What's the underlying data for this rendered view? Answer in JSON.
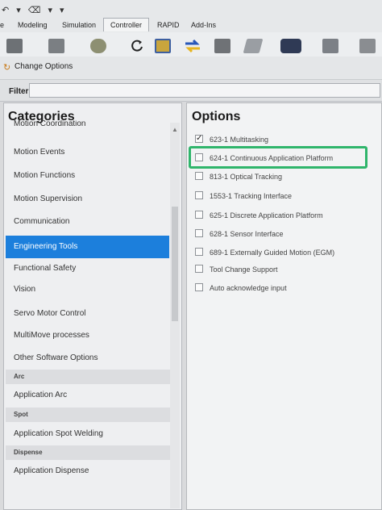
{
  "ribbon": {
    "qat": "↶ ▾ ⌫ ▾ ▾",
    "tabs": [
      {
        "label": "e"
      },
      {
        "label": "Modeling"
      },
      {
        "label": "Simulation"
      },
      {
        "label": "Controller"
      },
      {
        "label": "RAPID"
      },
      {
        "label": "Add-Ins"
      }
    ]
  },
  "header": {
    "title": "Change Options"
  },
  "filter": {
    "label": "Filter",
    "value": ""
  },
  "categories": {
    "title": "Categories",
    "items": [
      {
        "label": "Motion Coordination"
      },
      {
        "label": "Motion Events"
      },
      {
        "label": "Motion Functions"
      },
      {
        "label": "Motion Supervision"
      },
      {
        "label": "Communication"
      },
      {
        "label": "Engineering Tools"
      },
      {
        "label": "Functional Safety"
      },
      {
        "label": "Vision"
      },
      {
        "label": "Servo Motor Control"
      },
      {
        "label": "MultiMove processes"
      },
      {
        "label": "Other Software Options"
      }
    ],
    "sections": [
      {
        "header": "Arc",
        "item": "Application Arc"
      },
      {
        "header": "Spot",
        "item": "Application Spot Welding"
      },
      {
        "header": "Dispense",
        "item": "Application Dispense"
      }
    ]
  },
  "options": {
    "title": "Options",
    "items": [
      {
        "label": "623-1 Multitasking",
        "checked": true
      },
      {
        "label": "624-1 Continuous Application Platform",
        "checked": false
      },
      {
        "label": "813-1 Optical Tracking",
        "checked": false
      },
      {
        "label": "1553-1 Tracking Interface",
        "checked": false
      },
      {
        "label": "625-1 Discrete Application Platform",
        "checked": false
      },
      {
        "label": "628-1 Sensor Interface",
        "checked": false
      },
      {
        "label": "689-1 Externally Guided Motion (EGM)",
        "checked": false
      },
      {
        "label": "Tool Change Support",
        "checked": false
      },
      {
        "label": "Auto acknowledge input",
        "checked": false
      }
    ]
  },
  "colors": {
    "selection": "#1c7fdc",
    "highlight_box": "#2fb56b"
  }
}
